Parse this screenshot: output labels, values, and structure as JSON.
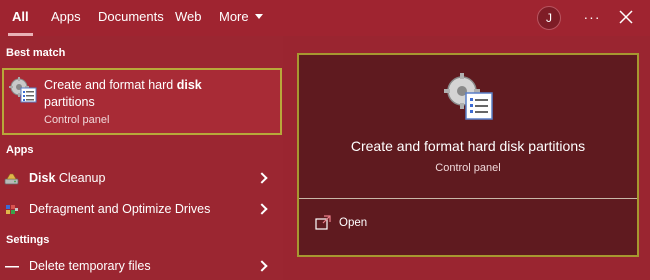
{
  "topbar": {
    "tabs": [
      {
        "label": "All"
      },
      {
        "label": "Apps"
      },
      {
        "label": "Documents"
      },
      {
        "label": "Web"
      },
      {
        "label": "More"
      }
    ],
    "avatar_initial": "J",
    "more_options_label": "···"
  },
  "left": {
    "best_match_label": "Best match",
    "best_match": {
      "title_prefix": "Create and format hard ",
      "title_bold": "disk",
      "title_suffix": "partitions",
      "subtitle": "Control panel"
    },
    "apps_label": "Apps",
    "apps": [
      {
        "bold": "Disk",
        "rest": " Cleanup"
      },
      {
        "bold": "",
        "rest": "Defragment and Optimize Drives"
      }
    ],
    "settings_label": "Settings",
    "settings": [
      {
        "label": "Delete temporary files"
      }
    ]
  },
  "preview": {
    "title": "Create and format hard disk partitions",
    "subtitle": "Control panel",
    "open_label": "Open"
  },
  "colors": {
    "background": "#9a2530",
    "preview_bg": "#5f1a1f",
    "highlight_border": "#b8a83a"
  }
}
